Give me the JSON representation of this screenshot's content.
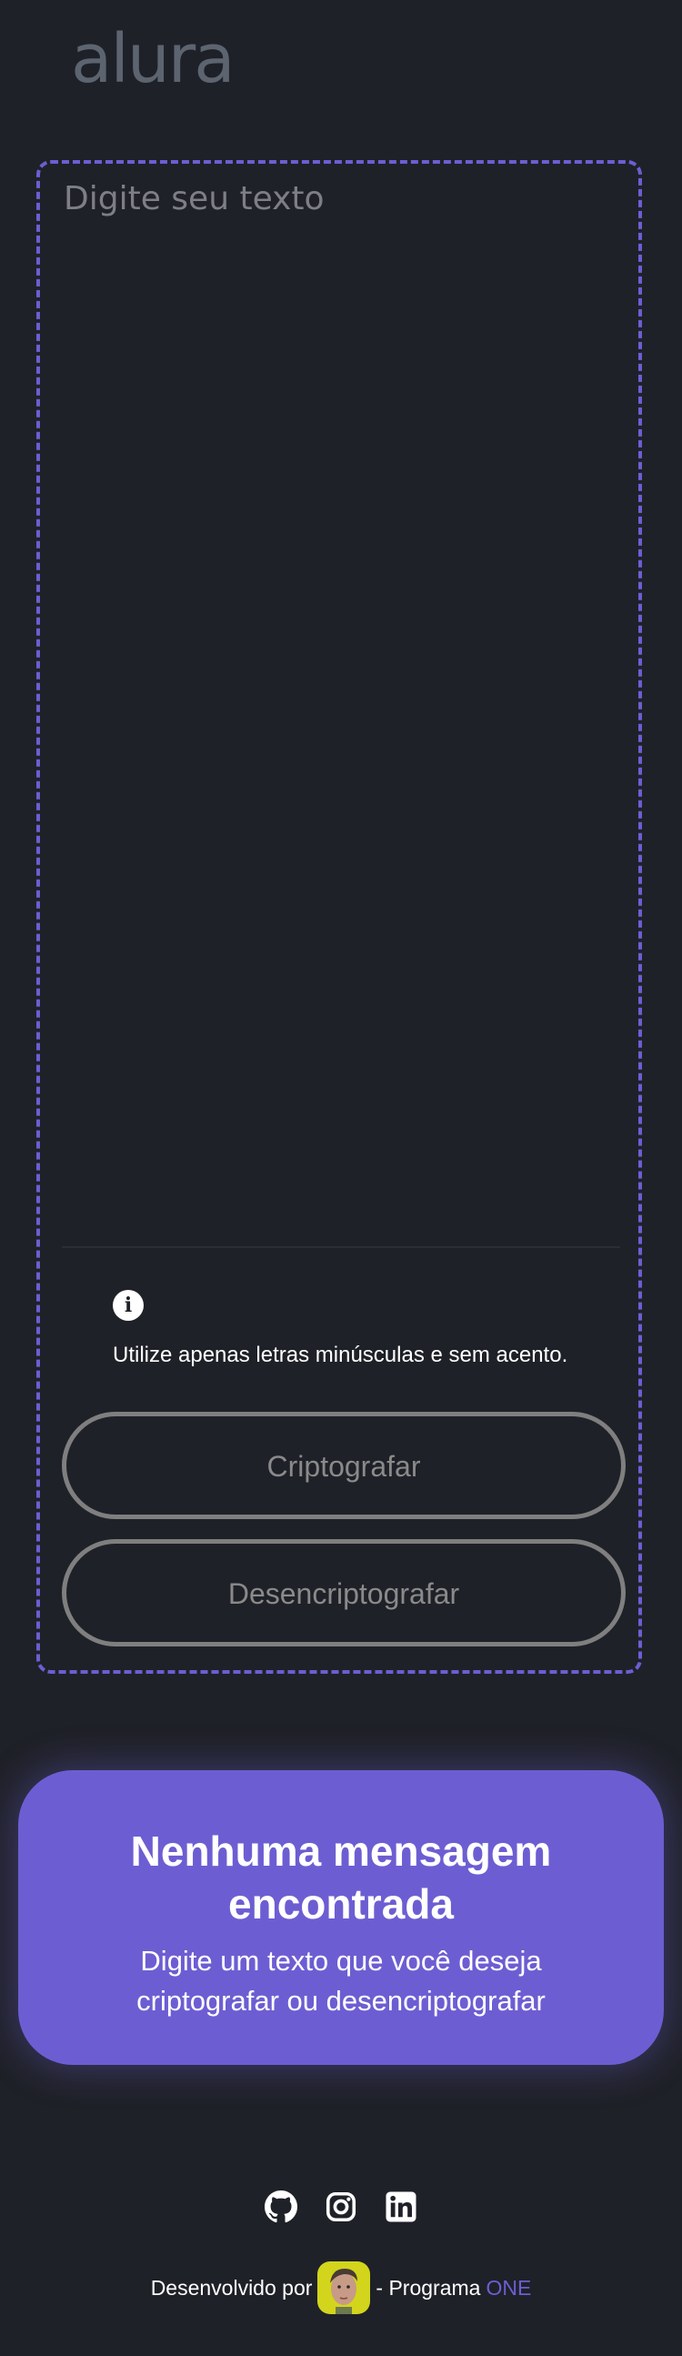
{
  "header": {
    "logo_text": "alura"
  },
  "input": {
    "placeholder": "Digite seu texto",
    "value": ""
  },
  "hint": {
    "icon": "info-icon",
    "text": "Utilize apenas letras minúsculas e sem acento."
  },
  "buttons": {
    "encrypt_label": "Criptografar",
    "decrypt_label": "Desencriptografar"
  },
  "output": {
    "title": "Nenhuma mensagem encontrada",
    "text": "Digite um texto que você deseja criptografar ou desencriptografar"
  },
  "social": [
    "github-icon",
    "instagram-icon",
    "linkedin-icon"
  ],
  "footer": {
    "prefix": "Desenvolvido por",
    "suffix": "- Programa",
    "brand": "ONE"
  },
  "colors": {
    "background": "#1f2128",
    "accent": "#6c5ed2",
    "logo": "#5c6470",
    "button_border": "#7f7f7f",
    "avatar_bg": "#d2d51c"
  }
}
